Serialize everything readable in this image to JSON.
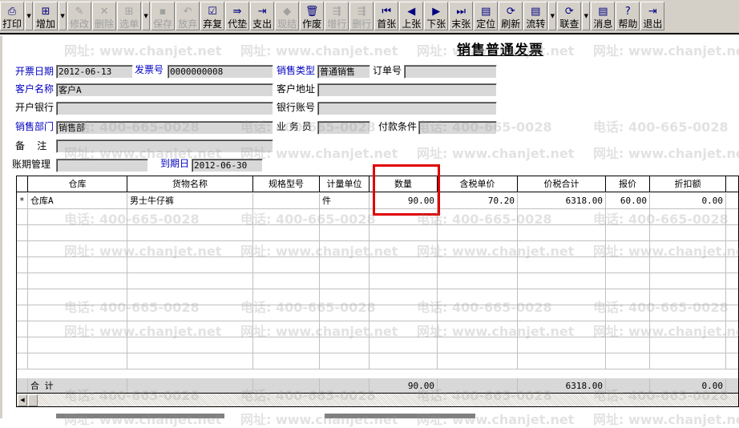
{
  "toolbar": {
    "buttons": [
      {
        "label": "打印",
        "icon": "printer-icon",
        "g": "⎙",
        "dis": false,
        "dd": true
      },
      {
        "label": "增加",
        "icon": "add-icon",
        "g": "⊞",
        "dis": false,
        "dd": true
      },
      {
        "label": "修改",
        "icon": "edit-icon",
        "g": "✎",
        "dis": true
      },
      {
        "label": "删除",
        "icon": "delete-icon",
        "g": "✕",
        "dis": true
      },
      {
        "label": "选单",
        "icon": "select-icon",
        "g": "⊞",
        "dis": true,
        "dd": true
      },
      {
        "label": "保存",
        "icon": "save-icon",
        "g": "▪",
        "dis": true
      },
      {
        "label": "放弃",
        "icon": "undo-icon",
        "g": "↶",
        "dis": true
      },
      {
        "label": "弃复",
        "icon": "restore-icon",
        "g": "☑",
        "dis": false
      },
      {
        "label": "代垫",
        "icon": "advance-icon",
        "g": "⇛",
        "dis": false
      },
      {
        "label": "支出",
        "icon": "expense-icon",
        "g": "⇥",
        "dis": false
      },
      {
        "label": "现结",
        "icon": "settle-icon",
        "g": "◆",
        "dis": true
      },
      {
        "label": "作废",
        "icon": "void-icon",
        "g": "🗑",
        "dis": false
      },
      {
        "label": "增行",
        "icon": "add-row-icon",
        "g": "⇶",
        "dis": true
      },
      {
        "label": "删行",
        "icon": "delete-row-icon",
        "g": "⇶",
        "dis": true
      },
      {
        "label": "首张",
        "icon": "first-icon",
        "g": "⏮",
        "dis": false
      },
      {
        "label": "上张",
        "icon": "prev-icon",
        "g": "◀",
        "dis": false
      },
      {
        "label": "下张",
        "icon": "next-icon",
        "g": "▶",
        "dis": false
      },
      {
        "label": "末张",
        "icon": "last-icon",
        "g": "⏭",
        "dis": false
      },
      {
        "label": "定位",
        "icon": "locate-icon",
        "g": "▤",
        "dis": false
      },
      {
        "label": "刷新",
        "icon": "refresh-icon",
        "g": "⟳",
        "dis": false
      },
      {
        "label": "流转",
        "icon": "flow-icon",
        "g": "▤",
        "dis": false,
        "dd": true
      },
      {
        "label": "联查",
        "icon": "query-icon",
        "g": "⟳",
        "dis": false,
        "dd": true
      },
      {
        "label": "消息",
        "icon": "message-icon",
        "g": "▤",
        "dis": false
      },
      {
        "label": "帮助",
        "icon": "help-icon",
        "g": "?",
        "dis": false
      },
      {
        "label": "退出",
        "icon": "exit-icon",
        "g": "⇥",
        "dis": false
      }
    ]
  },
  "title": "销售普通发票",
  "form": {
    "invoice_date_label": "开票日期",
    "invoice_date": "2012-06-13",
    "invoice_no_label": "发票号",
    "invoice_no": "0000000008",
    "sales_type_label": "销售类型",
    "sales_type": "普通销售",
    "order_no_label": "订单号",
    "order_no": "",
    "customer_label": "客户名称",
    "customer": "客户A",
    "address_label": "客户地址",
    "address": "",
    "bank_label": "开户银行",
    "bank": "",
    "account_label": "银行账号",
    "account": "",
    "dept_label": "销售部门",
    "dept": "销售部",
    "salesman_label": "业 务 员",
    "salesman": "",
    "terms_label": "付款条件",
    "terms": "",
    "remark_label": "备    注",
    "remark": "",
    "period_label": "账期管理",
    "period": "",
    "due_label": "到期日",
    "due": "2012-06-30"
  },
  "grid": {
    "headers": [
      "仓库",
      "货物名称",
      "规格型号",
      "计量单位",
      "数量",
      "含税单价",
      "价税合计",
      "报价",
      "折扣额",
      ""
    ],
    "rows": [
      [
        "仓库A",
        "男士牛仔裤",
        "",
        "件",
        "90.00",
        "70.20",
        "6318.00",
        "60.00",
        "0.00",
        ""
      ]
    ],
    "row_marker": "*",
    "total_label": "合 计",
    "totals": {
      "qty": "90.00",
      "amount": "6318.00",
      "discount": "0.00"
    }
  },
  "watermark": {
    "phone": "电话: 400-665-0028",
    "site": "网址: www.chanjet.net"
  },
  "colors": {
    "highlight": "#e00000",
    "required_label": "#0000c0"
  }
}
